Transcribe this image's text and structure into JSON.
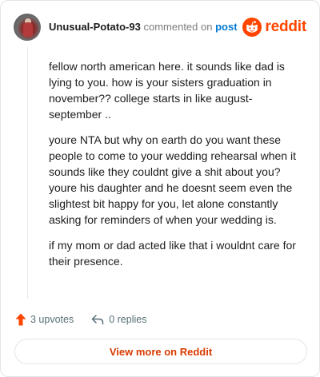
{
  "header": {
    "username": "Unusual-Potato-93",
    "action_text": "commented on",
    "post_link": "post",
    "logo_text": "reddit"
  },
  "comment": {
    "paragraphs": [
      "fellow north american here. it sounds like dad is lying to you. how is your sisters graduation in november?? college starts in like august-september ..",
      "youre NTA but why on earth do you want these people to come to your wedding rehearsal when it sounds like they couldnt give a shit about you? youre his daughter and he doesnt seem even the slightest bit happy for you, let alone constantly asking for reminders of when your wedding is.",
      "if my mom or dad acted like that i wouldnt care for their presence."
    ]
  },
  "actions": {
    "upvotes": "3 upvotes",
    "replies": "0 replies"
  },
  "footer": {
    "view_more": "View more on Reddit"
  },
  "colors": {
    "brand": "#ff4500",
    "link": "#0079d3",
    "view_more": "#d93a00"
  }
}
